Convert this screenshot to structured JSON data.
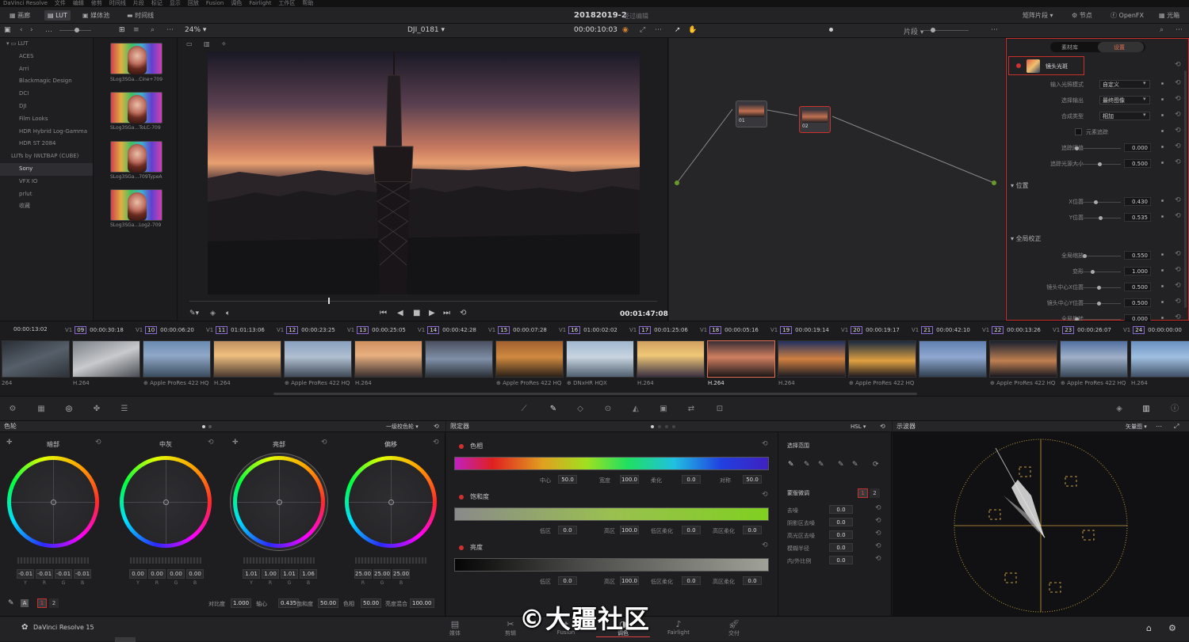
{
  "menubar": {
    "items": [
      "DaVinci Resolve",
      "文件",
      "编辑",
      "修剪",
      "时间线",
      "片段",
      "标记",
      "显示",
      "回放",
      "Fusion",
      "调色",
      "Fairlight",
      "工作区",
      "帮助"
    ]
  },
  "topbar": {
    "left_buttons": [
      "画廊",
      "LUT",
      "媒体池",
      "时间线"
    ],
    "project_title": "20182019-2",
    "project_subtitle": "经过编辑",
    "right_buttons": [
      "矩阵片段",
      "节点",
      "OpenFX",
      "光箱"
    ]
  },
  "viewer": {
    "zoom": "24%",
    "clip_name": "DJI_0181",
    "timecode_top": "00:00:10:03",
    "timecode_bottom": "00:01:47:08"
  },
  "node_editor": {
    "mode": "片段",
    "nodes": [
      {
        "label": "01"
      },
      {
        "label": "02"
      }
    ]
  },
  "lut_browser": {
    "root": "LUT",
    "items": [
      "ACES",
      "Arri",
      "Blackmagic Design",
      "DCI",
      "DJI",
      "Film Looks",
      "HDR Hybrid Log-Gamma",
      "HDR ST 2084",
      "LUTs by IWLTBAP (CUBE)",
      "Sony",
      "VFX IO",
      "prlut",
      "收藏"
    ],
    "selected": "Sony",
    "thumbs": [
      "SLog3SGa...Cine+709",
      "SLog3SGa...ToLC-709",
      "SLog3SGa...709TypeA",
      "SLog3SGa...Log2-709"
    ]
  },
  "inspector": {
    "tabs": [
      "素材库",
      "设置"
    ],
    "active_tab": "设置",
    "effect_name": "镜头光斑",
    "rows": [
      {
        "label": "输入光照模式",
        "value": "自定义"
      },
      {
        "label": "选择输出",
        "value": "最终图像"
      },
      {
        "label": "合成类型",
        "value": "相加"
      },
      {
        "label": "元素追踪",
        "value": ""
      },
      {
        "label": "追踪阈值",
        "value": "0.000"
      },
      {
        "label": "追踪光源大小",
        "value": "0.500"
      }
    ],
    "section_position": "位置",
    "position_rows": [
      {
        "label": "X位置",
        "value": "0.430"
      },
      {
        "label": "Y位置",
        "value": "0.535"
      }
    ],
    "section_global": "全局校正",
    "global_rows": [
      {
        "label": "全局缩放",
        "value": "0.550"
      },
      {
        "label": "变形",
        "value": "1.000"
      },
      {
        "label": "镜头中心X位置",
        "value": "0.500"
      },
      {
        "label": "镜头中心Y位置",
        "value": "0.500"
      },
      {
        "label": "全局旋转",
        "value": "0.000"
      }
    ]
  },
  "timeline": {
    "first_tc": "00:00:13:02",
    "clips": [
      {
        "num": "09",
        "track": "V1",
        "tc": "00:00:30:18",
        "codec": "H.264"
      },
      {
        "num": "10",
        "track": "V1",
        "tc": "00:00:06:20",
        "codec": "Apple ProRes 422 HQ"
      },
      {
        "num": "11",
        "track": "V1",
        "tc": "01:01:13:06",
        "codec": "H.264"
      },
      {
        "num": "12",
        "track": "V1",
        "tc": "00:00:23:25",
        "codec": "Apple ProRes 422 HQ"
      },
      {
        "num": "13",
        "track": "V1",
        "tc": "00:00:25:05",
        "codec": "H.264"
      },
      {
        "num": "14",
        "track": "V1",
        "tc": "00:00:42:28",
        "codec": ""
      },
      {
        "num": "15",
        "track": "V1",
        "tc": "00:00:07:28",
        "codec": "Apple ProRes 422 HQ"
      },
      {
        "num": "16",
        "track": "V1",
        "tc": "01:00:02:02",
        "codec": "DNxHR HQX"
      },
      {
        "num": "17",
        "track": "V1",
        "tc": "00:01:25:06",
        "codec": "H.264"
      },
      {
        "num": "18",
        "track": "V1",
        "tc": "00:00:05:16",
        "codec": "H.264"
      },
      {
        "num": "19",
        "track": "V1",
        "tc": "00:00:19:14",
        "codec": "H.264"
      },
      {
        "num": "20",
        "track": "V1",
        "tc": "00:00:19:17",
        "codec": "Apple ProRes 422 HQ"
      },
      {
        "num": "21",
        "track": "V1",
        "tc": "00:00:42:10",
        "codec": ""
      },
      {
        "num": "22",
        "track": "V1",
        "tc": "00:00:13:26",
        "codec": "Apple ProRes 422 HQ"
      },
      {
        "num": "23",
        "track": "V1",
        "tc": "00:00:26:07",
        "codec": "Apple ProRes 422 HQ"
      },
      {
        "num": "24",
        "track": "V1",
        "tc": "00:00:00:00",
        "codec": "H.264"
      }
    ],
    "first_codec": "264"
  },
  "color_wheels": {
    "title": "色轮",
    "mode": "一级校色轮",
    "wheels": [
      {
        "label": "暗部",
        "values": [
          "-0.01",
          "-0.01",
          "-0.01",
          "-0.01"
        ]
      },
      {
        "label": "中灰",
        "values": [
          "0.00",
          "0.00",
          "0.00",
          "0.00"
        ]
      },
      {
        "label": "亮部",
        "values": [
          "1.01",
          "1.00",
          "1.01",
          "1.06"
        ]
      },
      {
        "label": "偏移",
        "values": [
          "25.00",
          "25.00",
          "25.00"
        ]
      }
    ],
    "channel_labels": [
      "Y",
      "R",
      "G",
      "B"
    ],
    "offset_labels": [
      "R",
      "G",
      "B"
    ],
    "page_numbers": [
      "1",
      "2"
    ],
    "bottom": [
      {
        "label": "对比度",
        "value": "1.000"
      },
      {
        "label": "轴心",
        "value": "0.435"
      },
      {
        "label": "饱和度",
        "value": "50.00"
      },
      {
        "label": "色相",
        "value": "50.00"
      },
      {
        "label": "亮度混合",
        "value": "100.00"
      }
    ]
  },
  "qualifier": {
    "title": "限定器",
    "mode": "HSL",
    "sections": [
      {
        "name": "色相",
        "params": [
          {
            "l": "中心",
            "v": "50.0"
          },
          {
            "l": "宽度",
            "v": "100.0"
          },
          {
            "l": "柔化",
            "v": "0.0"
          },
          {
            "l": "对称",
            "v": "50.0"
          }
        ]
      },
      {
        "name": "饱和度",
        "params": [
          {
            "l": "低区",
            "v": "0.0"
          },
          {
            "l": "高区",
            "v": "100.0"
          },
          {
            "l": "低区柔化",
            "v": "0.0"
          },
          {
            "l": "高区柔化",
            "v": "0.0"
          }
        ]
      },
      {
        "name": "亮度",
        "params": [
          {
            "l": "低区",
            "v": "0.0"
          },
          {
            "l": "高区",
            "v": "100.0"
          },
          {
            "l": "低区柔化",
            "v": "0.0"
          },
          {
            "l": "高区柔化",
            "v": "0.0"
          }
        ]
      }
    ],
    "range_title": "选择范围",
    "matte_title": "蒙版微调",
    "matte_pages": [
      "1",
      "2"
    ],
    "matte_rows": [
      {
        "label": "去噪",
        "value": "0.0"
      },
      {
        "label": "阴影区去噪",
        "value": "0.0"
      },
      {
        "label": "高光区去噪",
        "value": "0.0"
      },
      {
        "label": "模糊半径",
        "value": "0.0"
      },
      {
        "label": "内/外比例",
        "value": "0.0"
      }
    ]
  },
  "scope": {
    "title": "示波器",
    "mode": "矢量图"
  },
  "statusbar": {
    "app": "DaVinci Resolve 15",
    "pages": [
      "媒体",
      "剪辑",
      "Fusion",
      "调色",
      "Fairlight",
      "交付"
    ],
    "active_page": "调色"
  },
  "watermark": "©大疆社区",
  "colors": {
    "accent_red": "#c8302c",
    "selection_orange": "#e07050"
  }
}
